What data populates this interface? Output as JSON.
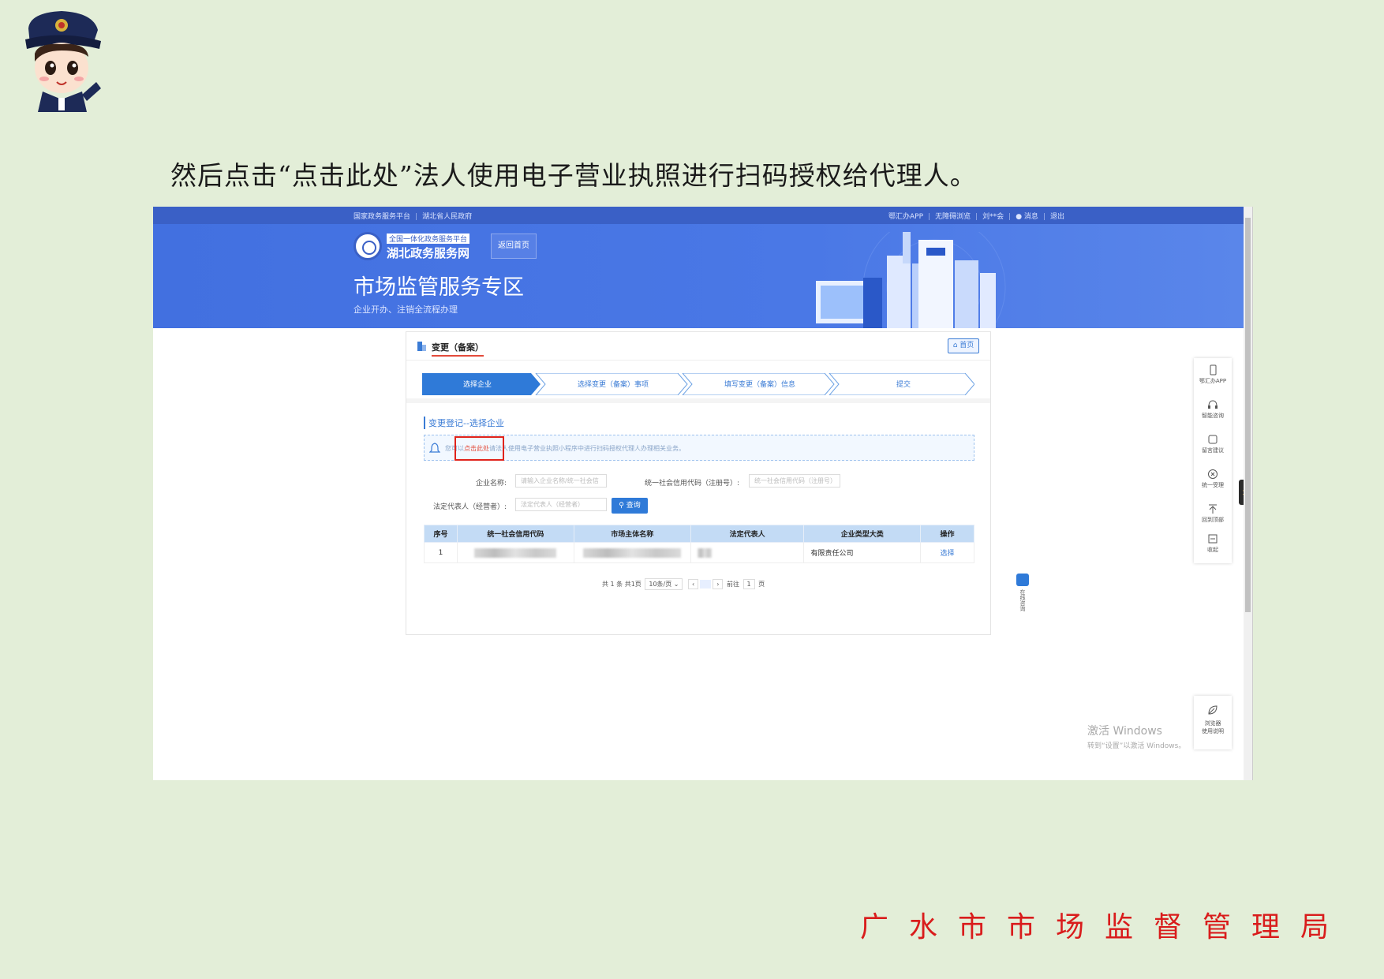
{
  "instruction": "然后点击“点击此处”法人使用电子营业执照进行扫码授权给代理人。",
  "footer_org": "广水市市场监督管理局",
  "topbar": {
    "left": [
      "国家政务服务平台",
      "湖北省人民政府"
    ],
    "right": [
      "鄂汇办APP",
      "无障碍浏览",
      "刘**会",
      "消息",
      "退出"
    ]
  },
  "banner": {
    "logo_top": "全国一体化政务服务平台",
    "logo_main": "湖北政务服务网",
    "back_home": "返回首页",
    "title": "市场监管服务专区",
    "subtitle": "企业开办、注销全流程办理"
  },
  "panel": {
    "title": "变更（备案）",
    "home_button": "首页",
    "steps": [
      "选择企业",
      "选择变更（备案）事项",
      "填写变更（备案）信息",
      "提交"
    ],
    "section_title": "变更登记--选择企业",
    "notice": {
      "before": "您可以",
      "link": "点击此处",
      "after": "请法人使用电子营业执照小程序中进行扫码授权代理人办理相关业务。"
    },
    "form": {
      "company_name_label": "企业名称:",
      "company_name_placeholder": "请输入企业名称/统一社会信",
      "credit_code_label": "统一社会信用代码（注册号）:",
      "credit_code_placeholder": "统一社会信用代码（注册号）",
      "legal_rep_label": "法定代表人（经营者）:",
      "legal_rep_placeholder": "法定代表人（经营者）",
      "search_button": "查询"
    },
    "table": {
      "headers": [
        "序号",
        "统一社会信用代码",
        "市场主体名称",
        "法定代表人",
        "企业类型大类",
        "操作"
      ],
      "rows": [
        {
          "index": "1",
          "company_type": "有限责任公司",
          "action": "选择"
        }
      ]
    },
    "pagination": {
      "summary": "共 1 条  共1页",
      "page_size": "10条/页",
      "goto_label": "前往",
      "goto_value": "1",
      "page_suffix": "页"
    }
  },
  "float_bar": [
    "鄂汇办APP",
    "智能咨询",
    "留言建议",
    "统一受理",
    "回到顶部",
    "收起"
  ],
  "float_bar2": [
    "浏览器",
    "使用说明"
  ],
  "side_consult": "在线咨询",
  "watermark": {
    "line1": "激活 Windows",
    "line2": "转到“设置”以激活 Windows。"
  }
}
